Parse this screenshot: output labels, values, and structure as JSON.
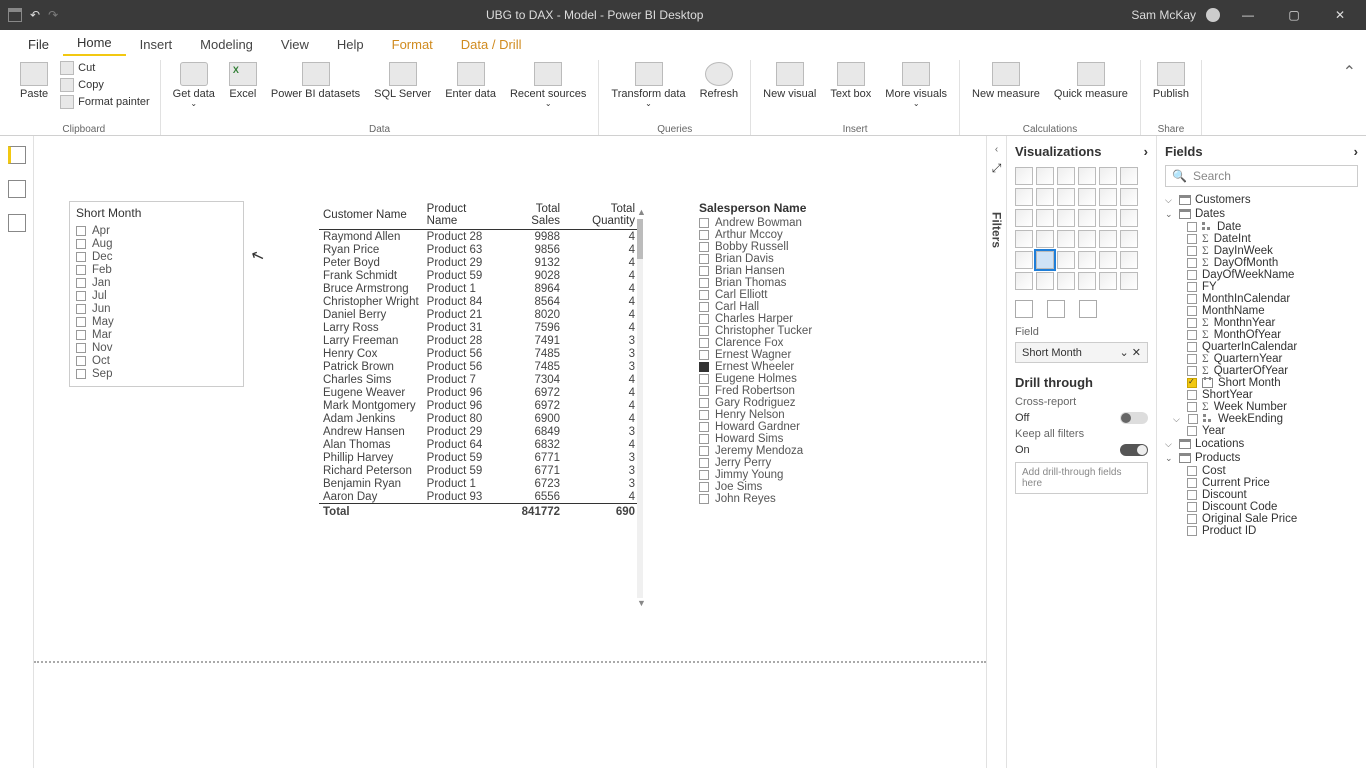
{
  "titlebar": {
    "title": "UBG to DAX - Model - Power BI Desktop",
    "user": "Sam McKay",
    "undo_tip": "↶",
    "redo_tip": "↷"
  },
  "menu": {
    "tabs": [
      "File",
      "Home",
      "Insert",
      "Modeling",
      "View",
      "Help",
      "Format",
      "Data / Drill"
    ],
    "active": "Home"
  },
  "ribbon": {
    "clipboard": {
      "label": "Clipboard",
      "paste": "Paste",
      "cut": "Cut",
      "copy": "Copy",
      "painter": "Format painter"
    },
    "data": {
      "label": "Data",
      "get": "Get data",
      "excel": "Excel",
      "pbi": "Power BI datasets",
      "sql": "SQL Server",
      "enter": "Enter data",
      "recent": "Recent sources"
    },
    "queries": {
      "label": "Queries",
      "transform": "Transform data",
      "refresh": "Refresh"
    },
    "insert": {
      "label": "Insert",
      "newvisual": "New visual",
      "textbox": "Text box",
      "more": "More visuals"
    },
    "calc": {
      "label": "Calculations",
      "newmeasure": "New measure",
      "quick": "Quick measure"
    },
    "share": {
      "label": "Share",
      "publish": "Publish"
    }
  },
  "slicer_month": {
    "title": "Short Month",
    "items": [
      "Apr",
      "Aug",
      "Dec",
      "Feb",
      "Jan",
      "Jul",
      "Jun",
      "May",
      "Mar",
      "Nov",
      "Oct",
      "Sep"
    ]
  },
  "table": {
    "headers": [
      "Customer Name",
      "Product Name",
      "Total Sales",
      "Total Quantity"
    ],
    "rows": [
      [
        "Raymond Allen",
        "Product 28",
        "9988",
        "4"
      ],
      [
        "Ryan Price",
        "Product 63",
        "9856",
        "4"
      ],
      [
        "Peter Boyd",
        "Product 29",
        "9132",
        "4"
      ],
      [
        "Frank Schmidt",
        "Product 59",
        "9028",
        "4"
      ],
      [
        "Bruce Armstrong",
        "Product 1",
        "8964",
        "4"
      ],
      [
        "Christopher Wright",
        "Product 84",
        "8564",
        "4"
      ],
      [
        "Daniel Berry",
        "Product 21",
        "8020",
        "4"
      ],
      [
        "Larry Ross",
        "Product 31",
        "7596",
        "4"
      ],
      [
        "Larry Freeman",
        "Product 28",
        "7491",
        "3"
      ],
      [
        "Henry Cox",
        "Product 56",
        "7485",
        "3"
      ],
      [
        "Patrick Brown",
        "Product 56",
        "7485",
        "3"
      ],
      [
        "Charles Sims",
        "Product 7",
        "7304",
        "4"
      ],
      [
        "Eugene Weaver",
        "Product 96",
        "6972",
        "4"
      ],
      [
        "Mark Montgomery",
        "Product 96",
        "6972",
        "4"
      ],
      [
        "Adam Jenkins",
        "Product 80",
        "6900",
        "4"
      ],
      [
        "Andrew Hansen",
        "Product 29",
        "6849",
        "3"
      ],
      [
        "Alan Thomas",
        "Product 64",
        "6832",
        "4"
      ],
      [
        "Phillip Harvey",
        "Product 59",
        "6771",
        "3"
      ],
      [
        "Richard Peterson",
        "Product 59",
        "6771",
        "3"
      ],
      [
        "Benjamin Ryan",
        "Product 1",
        "6723",
        "3"
      ],
      [
        "Aaron Day",
        "Product 93",
        "6556",
        "4"
      ]
    ],
    "total": {
      "label": "Total",
      "sales": "841772",
      "qty": "690"
    }
  },
  "slicer_sp": {
    "title": "Salesperson Name",
    "items": [
      "Andrew Bowman",
      "Arthur Mccoy",
      "Bobby Russell",
      "Brian Davis",
      "Brian Hansen",
      "Brian Thomas",
      "Carl Elliott",
      "Carl Hall",
      "Charles Harper",
      "Christopher Tucker",
      "Clarence Fox",
      "Ernest Wagner",
      "Ernest Wheeler",
      "Eugene Holmes",
      "Fred Robertson",
      "Gary Rodriguez",
      "Henry Nelson",
      "Howard Gardner",
      "Howard Sims",
      "Jeremy Mendoza",
      "Jerry Perry",
      "Jimmy Young",
      "Joe Sims",
      "John Reyes"
    ],
    "selected": "Ernest Wheeler"
  },
  "filters_label": "Filters",
  "viz": {
    "title": "Visualizations",
    "field_label": "Field",
    "field_value": "Short Month",
    "drill_title": "Drill through",
    "cross": "Cross-report",
    "cross_state": "Off",
    "keep": "Keep all filters",
    "keep_state": "On",
    "drop": "Add drill-through fields here"
  },
  "fields": {
    "title": "Fields",
    "search": "Search",
    "tables": [
      {
        "name": "Customers",
        "open": false
      },
      {
        "name": "Dates",
        "open": true,
        "children": [
          {
            "name": "Date",
            "type": "hier",
            "open": false
          },
          {
            "name": "DateInt",
            "type": "sigma"
          },
          {
            "name": "DayInWeek",
            "type": "sigma"
          },
          {
            "name": "DayOfMonth",
            "type": "sigma"
          },
          {
            "name": "DayOfWeekName",
            "type": "text"
          },
          {
            "name": "FY",
            "type": "text"
          },
          {
            "name": "MonthInCalendar",
            "type": "text"
          },
          {
            "name": "MonthName",
            "type": "text"
          },
          {
            "name": "MonthnYear",
            "type": "sigma"
          },
          {
            "name": "MonthOfYear",
            "type": "sigma"
          },
          {
            "name": "QuarterInCalendar",
            "type": "text"
          },
          {
            "name": "QuarternYear",
            "type": "sigma"
          },
          {
            "name": "QuarterOfYear",
            "type": "sigma"
          },
          {
            "name": "Short Month",
            "type": "cal",
            "checked": true
          },
          {
            "name": "ShortYear",
            "type": "text"
          },
          {
            "name": "Week Number",
            "type": "sigma"
          },
          {
            "name": "WeekEnding",
            "type": "hier",
            "open": false,
            "caret": true
          },
          {
            "name": "Year",
            "type": "text"
          }
        ]
      },
      {
        "name": "Locations",
        "open": false
      },
      {
        "name": "Products",
        "open": true,
        "children": [
          {
            "name": "Cost",
            "type": "text"
          },
          {
            "name": "Current Price",
            "type": "text"
          },
          {
            "name": "Discount",
            "type": "text"
          },
          {
            "name": "Discount Code",
            "type": "text"
          },
          {
            "name": "Original Sale Price",
            "type": "text"
          },
          {
            "name": "Product ID",
            "type": "text"
          }
        ]
      }
    ]
  }
}
